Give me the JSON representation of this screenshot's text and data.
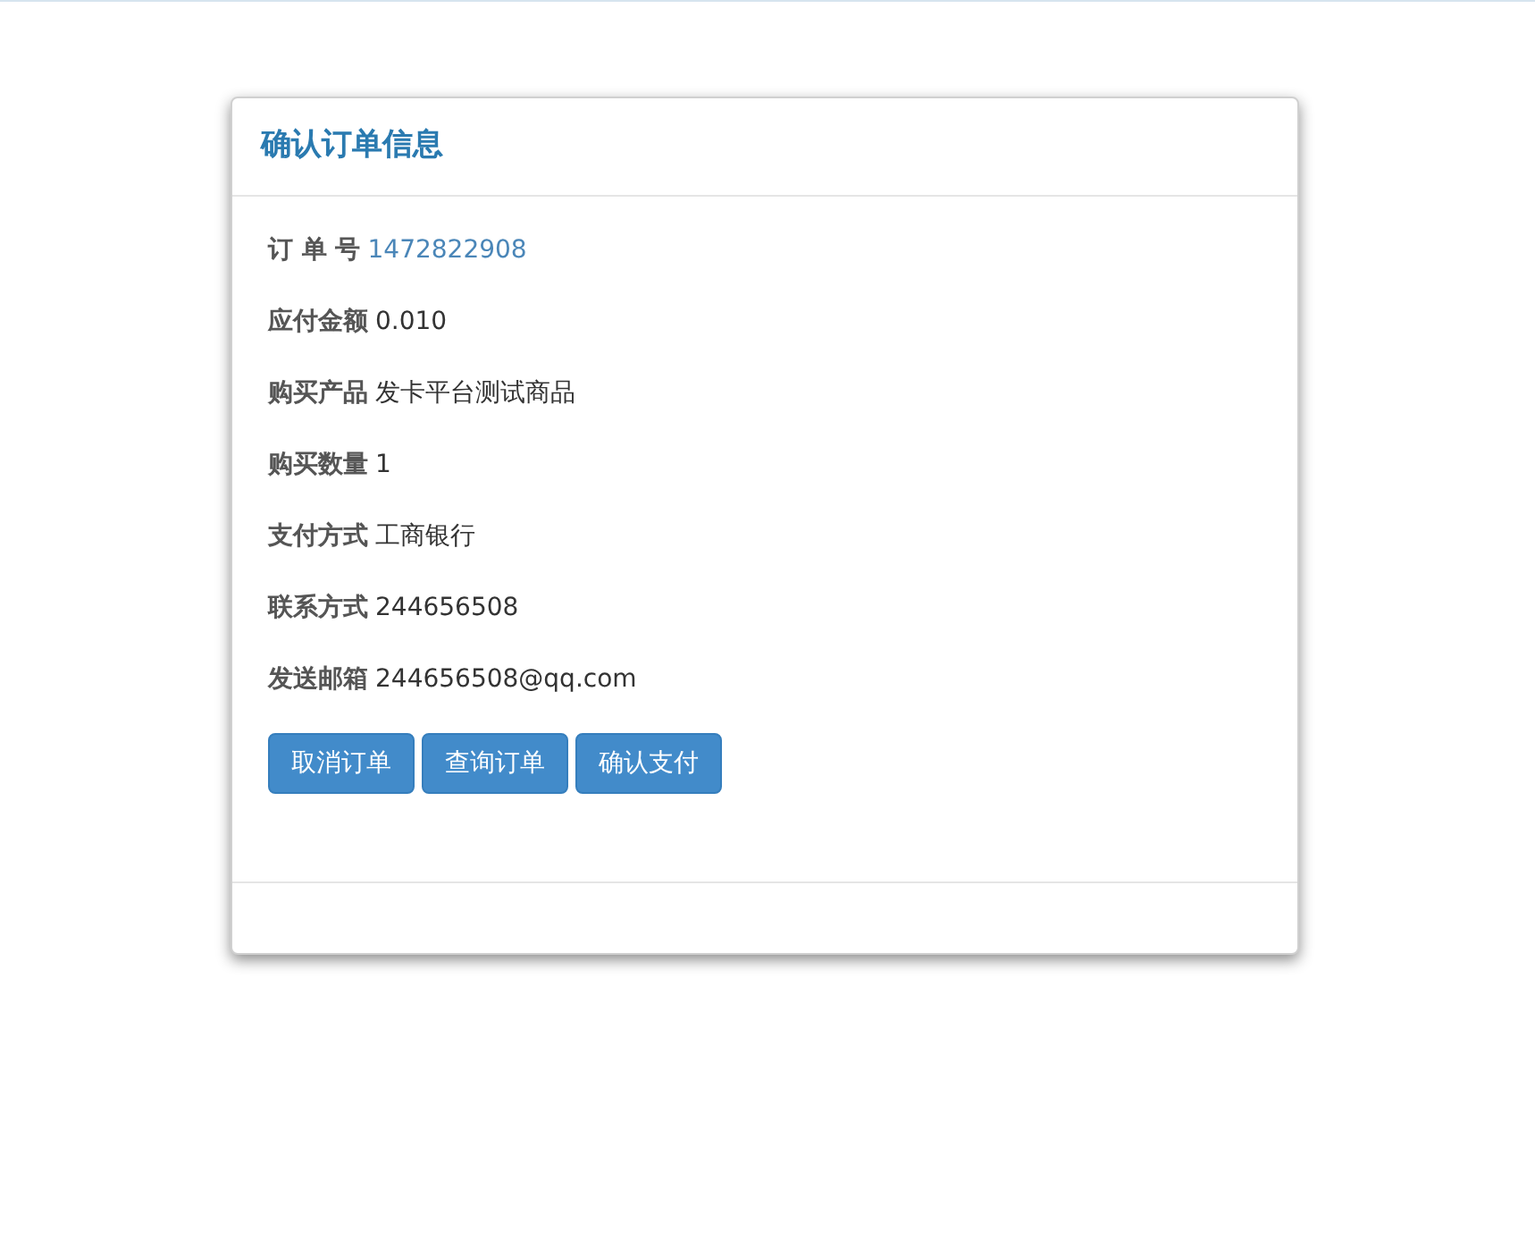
{
  "panel": {
    "title": "确认订单信息"
  },
  "fields": [
    {
      "label": "订 单 号",
      "value": "1472822908",
      "kind": "link"
    },
    {
      "label": "应付金额",
      "value": "0.010",
      "kind": "text"
    },
    {
      "label": "购买产品",
      "value": "发卡平台测试商品",
      "kind": "text"
    },
    {
      "label": "购买数量",
      "value": "1",
      "kind": "text"
    },
    {
      "label": "支付方式",
      "value": "工商银行",
      "kind": "text"
    },
    {
      "label": "联系方式",
      "value": "244656508",
      "kind": "text"
    },
    {
      "label": "发送邮箱",
      "value": "244656508@qq.com",
      "kind": "text"
    }
  ],
  "buttons": [
    "取消订单",
    "查询订单",
    "确认支付"
  ]
}
